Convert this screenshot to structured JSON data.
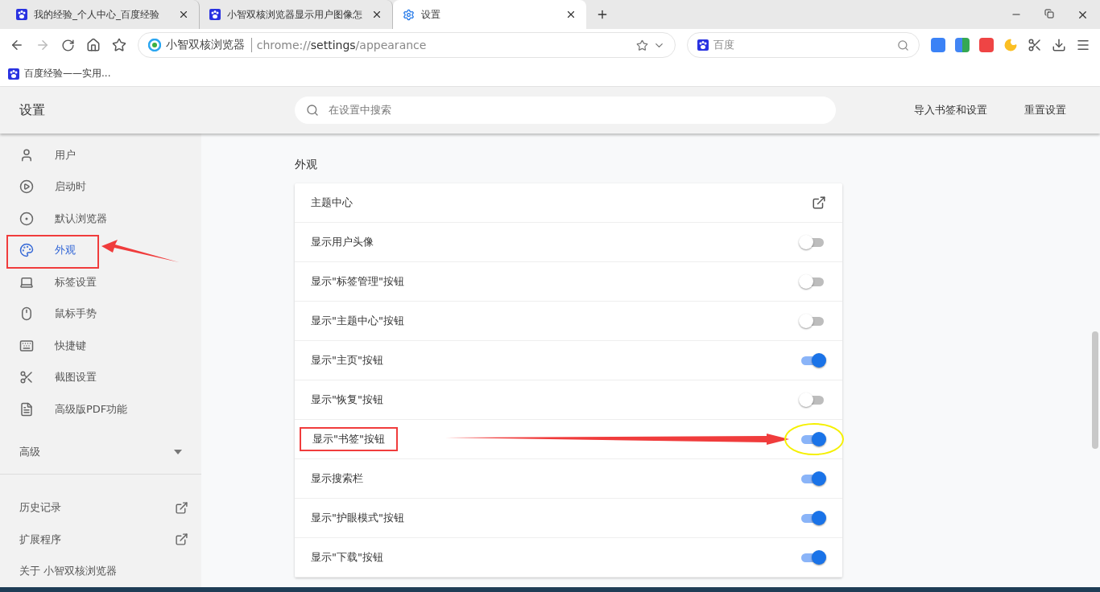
{
  "tabs": [
    {
      "title": "我的经验_个人中心_百度经验",
      "kind": "page",
      "selected": false
    },
    {
      "title": "小智双核浏览器显示用户图像怎",
      "kind": "page",
      "selected": false
    },
    {
      "title": "设置",
      "kind": "settings",
      "selected": true
    }
  ],
  "address": {
    "site": "小智双核浏览器",
    "url_prefix": "chrome://",
    "url_host": "settings",
    "url_path": "/appearance"
  },
  "search_box": {
    "placeholder": "百度"
  },
  "bookmarks": [
    {
      "title": "百度经验——实用..."
    }
  ],
  "settings_header": {
    "title": "设置",
    "search_placeholder": "在设置中搜索",
    "actions": [
      "导入书签和设置",
      "重置设置"
    ]
  },
  "sidebar": {
    "items": [
      {
        "label": "用户",
        "selected": false,
        "annotated": false
      },
      {
        "label": "启动时",
        "selected": false,
        "annotated": false
      },
      {
        "label": "默认浏览器",
        "selected": false,
        "annotated": false
      },
      {
        "label": "外观",
        "selected": true,
        "annotated": true
      },
      {
        "label": "标签设置",
        "selected": false,
        "annotated": false
      },
      {
        "label": "鼠标手势",
        "selected": false,
        "annotated": false
      },
      {
        "label": "快捷键",
        "selected": false,
        "annotated": false
      },
      {
        "label": "截图设置",
        "selected": false,
        "annotated": false
      },
      {
        "label": "高级版PDF功能",
        "selected": false,
        "annotated": false
      }
    ],
    "advanced": {
      "label": "高级",
      "expanded": false
    },
    "links": [
      "历史记录",
      "扩展程序"
    ],
    "about": "关于 小智双核浏览器"
  },
  "section": {
    "title": "外观",
    "rows": [
      {
        "kind": "link",
        "label": "主题中心",
        "annotated": false
      },
      {
        "kind": "toggle",
        "label": "显示用户头像",
        "on": false,
        "annotated": false
      },
      {
        "kind": "toggle",
        "label": "显示\"标签管理\"按钮",
        "on": false,
        "annotated": false
      },
      {
        "kind": "toggle",
        "label": "显示\"主题中心\"按钮",
        "on": false,
        "annotated": false
      },
      {
        "kind": "toggle",
        "label": "显示\"主页\"按钮",
        "on": true,
        "annotated": false
      },
      {
        "kind": "toggle",
        "label": "显示\"恢复\"按钮",
        "on": false,
        "annotated": false
      },
      {
        "kind": "toggle",
        "label": "显示\"书签\"按钮",
        "on": true,
        "annotated": true
      },
      {
        "kind": "toggle",
        "label": "显示搜索栏",
        "on": true,
        "annotated": false
      },
      {
        "kind": "toggle",
        "label": "显示\"护眼模式\"按钮",
        "on": true,
        "annotated": false
      },
      {
        "kind": "toggle",
        "label": "显示\"下载\"按钮",
        "on": true,
        "annotated": false
      }
    ]
  }
}
